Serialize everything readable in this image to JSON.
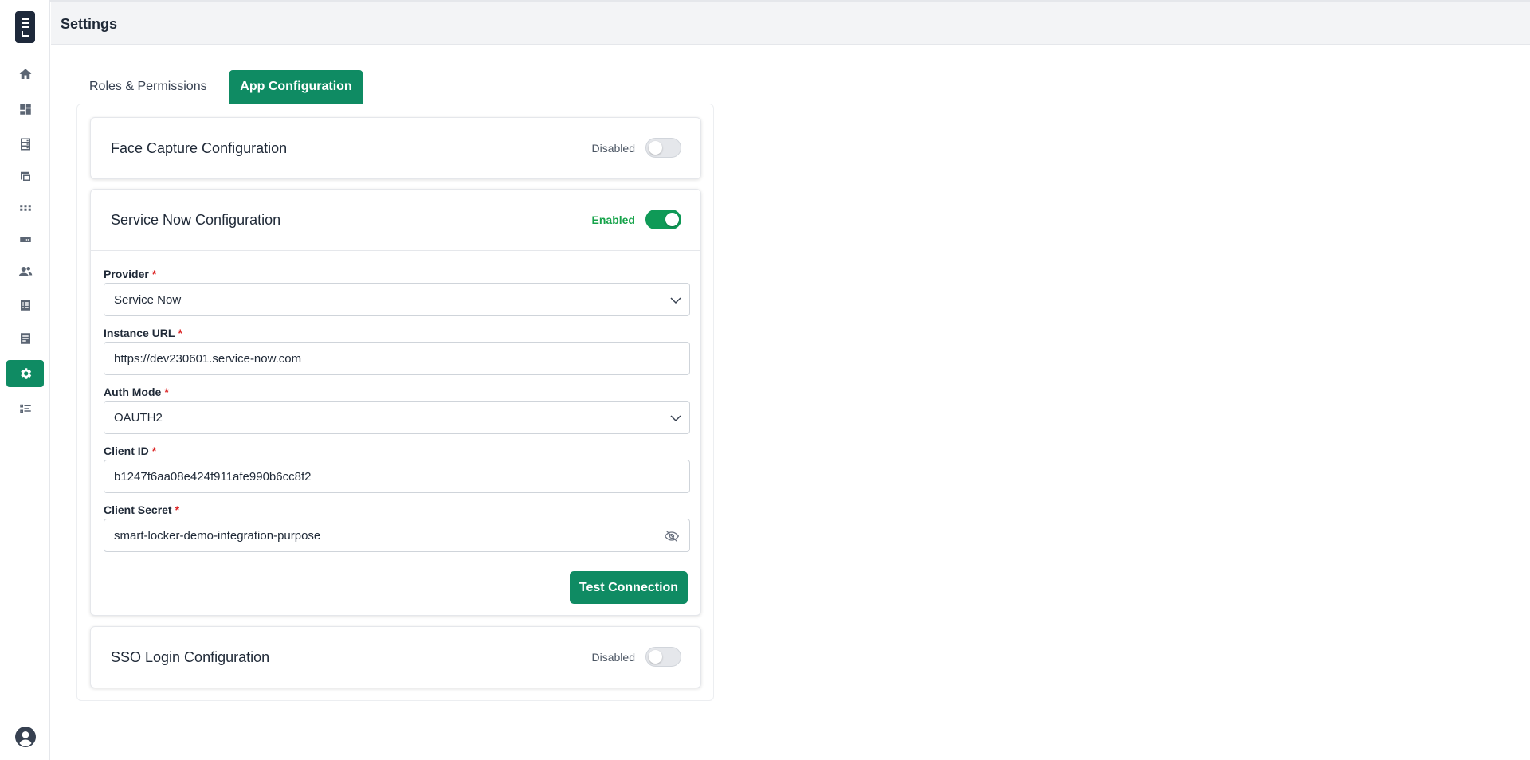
{
  "header": {
    "title": "Settings"
  },
  "sidebar": {
    "items": [
      {
        "icon": "home-icon",
        "active": false
      },
      {
        "icon": "dashboard-icon",
        "active": false
      },
      {
        "icon": "locker-icon",
        "active": false
      },
      {
        "icon": "devices-icon",
        "active": false
      },
      {
        "icon": "apps-grid-icon",
        "active": false
      },
      {
        "icon": "badge-icon",
        "active": false
      },
      {
        "icon": "users-icon",
        "active": false
      },
      {
        "icon": "list-icon",
        "active": false
      },
      {
        "icon": "document-icon",
        "active": false
      },
      {
        "icon": "gear-icon",
        "active": true
      },
      {
        "icon": "checklist-icon",
        "active": false
      }
    ],
    "user_icon": "account-circle-icon"
  },
  "tabs": [
    {
      "label": "Roles & Permissions",
      "active": false
    },
    {
      "label": "App Configuration",
      "active": true
    }
  ],
  "face_capture": {
    "title": "Face Capture Configuration",
    "status": "Disabled",
    "enabled": false
  },
  "service_now": {
    "title": "Service Now Configuration",
    "status": "Enabled",
    "enabled": true,
    "provider": {
      "label": "Provider",
      "required_mark": "*",
      "value": "Service Now"
    },
    "instance_url": {
      "label": "Instance URL",
      "required_mark": "*",
      "value": "https://dev230601.service-now.com"
    },
    "auth_mode": {
      "label": "Auth Mode",
      "required_mark": "*",
      "value": "OAUTH2"
    },
    "client_id": {
      "label": "Client ID",
      "required_mark": "*",
      "value": "b1247f6aa08e424f911afe990b6cc8f2"
    },
    "client_secret": {
      "label": "Client Secret",
      "required_mark": "*",
      "value": "smart-locker-demo-integration-purpose"
    },
    "test_button": "Test Connection"
  },
  "sso": {
    "title": "SSO Login Configuration",
    "status": "Disabled",
    "enabled": false
  },
  "colors": {
    "accent": "#0f8b63",
    "enabled_green": "#16a34a",
    "required_red": "#dc2626"
  }
}
